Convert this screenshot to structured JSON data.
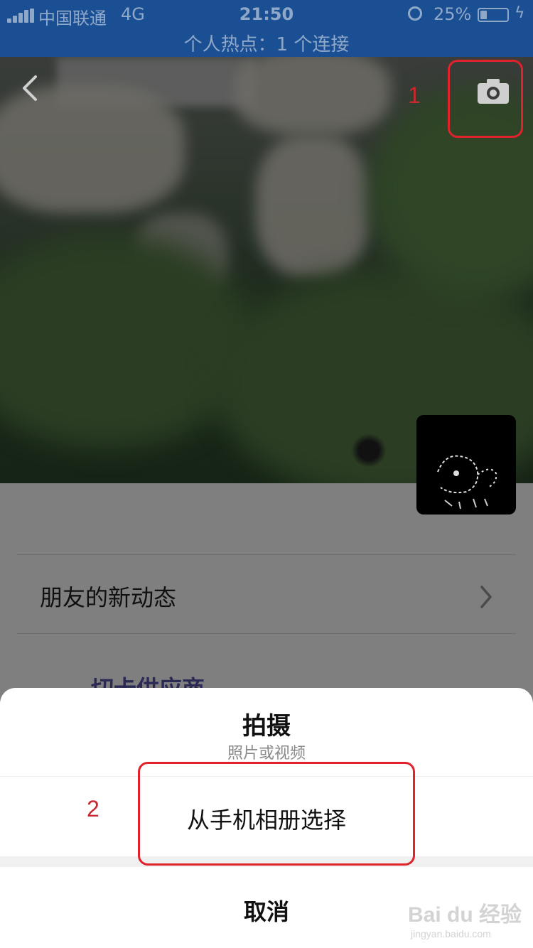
{
  "status_bar": {
    "carrier": "中国联通",
    "network": "4G",
    "time": "21:50",
    "battery_percent": "25%",
    "battery_level": 0.25,
    "hotspot": "个人热点：1 个连接"
  },
  "cover": {
    "back_icon": "chevron-left-icon",
    "camera_icon": "camera-icon",
    "annotation_1": "1"
  },
  "list": {
    "friends_updates": "朋友的新动态",
    "supplier_partial": "切卡供应商"
  },
  "action_sheet": {
    "shoot_title": "拍摄",
    "shoot_subtitle": "照片或视频",
    "album": "从手机相册选择",
    "cancel": "取消",
    "annotation_2": "2"
  },
  "watermark": {
    "brand": "Bai du 经验",
    "url": "jingyan.baidu.com"
  },
  "colors": {
    "status_bar": "#1b4f93",
    "highlight": "#e0222c"
  }
}
